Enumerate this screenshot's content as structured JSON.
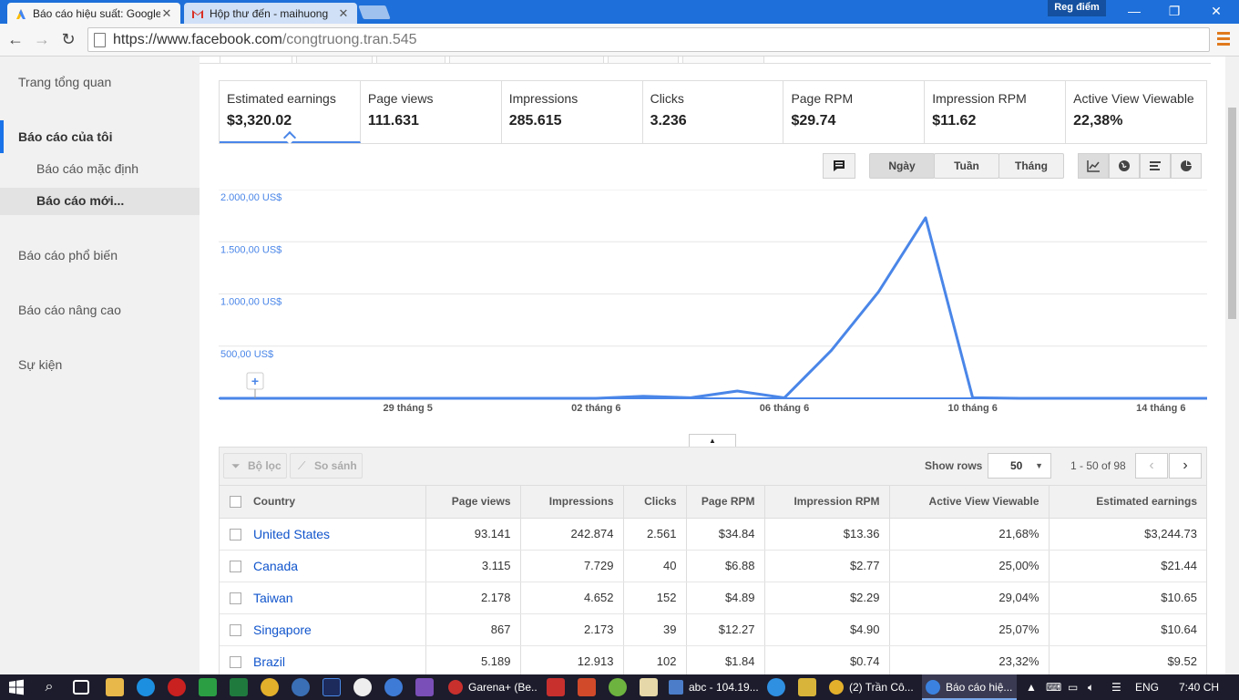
{
  "browser": {
    "tabs": [
      {
        "title": "Báo cáo hiệu suất: Google",
        "active": true
      },
      {
        "title": "Hộp thư đến - maihuong",
        "active": false
      }
    ],
    "profile_label": "Reg điểm",
    "url_host": "https://www.facebook.com",
    "url_path": "/congtruong.tran.545",
    "icons": [
      "back-icon",
      "forward-icon",
      "reload-icon",
      "menu-icon"
    ]
  },
  "sidebar": {
    "items": [
      {
        "label": "Trang tổng quan"
      },
      {
        "label": "Báo cáo của tôi"
      },
      {
        "label": "Báo cáo mặc định"
      },
      {
        "label": "Báo cáo mới..."
      },
      {
        "label": "Báo cáo phổ biến"
      },
      {
        "label": "Báo cáo nâng cao"
      },
      {
        "label": "Sự kiện"
      }
    ]
  },
  "metrics": [
    {
      "label": "Estimated earnings",
      "value": "$3,320.02",
      "selected": true
    },
    {
      "label": "Page views",
      "value": "111.631"
    },
    {
      "label": "Impressions",
      "value": "285.615"
    },
    {
      "label": "Clicks",
      "value": "3.236"
    },
    {
      "label": "Page RPM",
      "value": "$29.74"
    },
    {
      "label": "Impression RPM",
      "value": "$11.62"
    },
    {
      "label": "Active View Viewable",
      "value": "22,38%"
    }
  ],
  "granularity": {
    "options": [
      "Ngày",
      "Tuần",
      "Tháng"
    ],
    "selected": "Ngày"
  },
  "view_icons": [
    "comment-icon",
    "line-chart-icon",
    "globe-icon",
    "bar-list-icon",
    "pie-chart-icon"
  ],
  "chart_data": {
    "type": "line",
    "title": "",
    "xlabel": "",
    "ylabel": "",
    "ylim": [
      0,
      2000
    ],
    "y_ticks": [
      "2.000,00 US$",
      "1.500,00 US$",
      "1.000,00 US$",
      "500,00 US$"
    ],
    "y_tick_values": [
      2000,
      1500,
      1000,
      500
    ],
    "x_tick_labels": [
      "29 tháng 5",
      "02 tháng 6",
      "06 tháng 6",
      "10 tháng 6",
      "14 tháng 6"
    ],
    "x_tick_index": [
      4,
      8,
      12,
      16,
      20
    ],
    "x": [
      "25 tháng 5",
      "26 tháng 5",
      "27 tháng 5",
      "28 tháng 5",
      "29 tháng 5",
      "30 tháng 5",
      "31 tháng 5",
      "01 tháng 6",
      "02 tháng 6",
      "03 tháng 6",
      "04 tháng 6",
      "05 tháng 6",
      "06 tháng 6",
      "07 tháng 6",
      "08 tháng 6",
      "09 tháng 6",
      "10 tháng 6",
      "11 tháng 6",
      "12 tháng 6",
      "13 tháng 6",
      "14 tháng 6",
      "15 tháng 6"
    ],
    "series": [
      {
        "values": [
          0,
          0,
          0,
          0,
          0,
          0,
          0,
          0,
          0,
          20,
          5,
          70,
          5,
          460,
          1020,
          1730,
          5,
          0,
          0,
          0,
          0,
          0
        ],
        "color": "#4a86e8"
      }
    ],
    "grid": true
  },
  "table": {
    "filter_label": "Bộ lọc",
    "compare_label": "So sánh",
    "show_rows_label": "Show rows",
    "rows_value": "50",
    "page_info": "1 - 50 of 98",
    "columns": [
      "Country",
      "Page views",
      "Impressions",
      "Clicks",
      "Page RPM",
      "Impression RPM",
      "Active View Viewable",
      "Estimated earnings"
    ],
    "rows": [
      {
        "country": "United States",
        "page_views": "93.141",
        "impressions": "242.874",
        "clicks": "2.561",
        "page_rpm": "$34.84",
        "impression_rpm": "$13.36",
        "active_view": "21,68%",
        "earnings": "$3,244.73"
      },
      {
        "country": "Canada",
        "page_views": "3.115",
        "impressions": "7.729",
        "clicks": "40",
        "page_rpm": "$6.88",
        "impression_rpm": "$2.77",
        "active_view": "25,00%",
        "earnings": "$21.44"
      },
      {
        "country": "Taiwan",
        "page_views": "2.178",
        "impressions": "4.652",
        "clicks": "152",
        "page_rpm": "$4.89",
        "impression_rpm": "$2.29",
        "active_view": "29,04%",
        "earnings": "$10.65"
      },
      {
        "country": "Singapore",
        "page_views": "867",
        "impressions": "2.173",
        "clicks": "39",
        "page_rpm": "$12.27",
        "impression_rpm": "$4.90",
        "active_view": "25,07%",
        "earnings": "$10.64"
      },
      {
        "country": "Brazil",
        "page_views": "5.189",
        "impressions": "12.913",
        "clicks": "102",
        "page_rpm": "$1.84",
        "impression_rpm": "$0.74",
        "active_view": "23,32%",
        "earnings": "$9.52"
      }
    ]
  },
  "taskbar": {
    "tasks": [
      {
        "label": "Garena+ (Be..."
      },
      {
        "label": "abc - 104.19..."
      },
      {
        "label": "(2) Trần Cô..."
      },
      {
        "label": "Báo cáo hiệ..."
      }
    ],
    "lang": "ENG",
    "time": "7:40 CH"
  }
}
